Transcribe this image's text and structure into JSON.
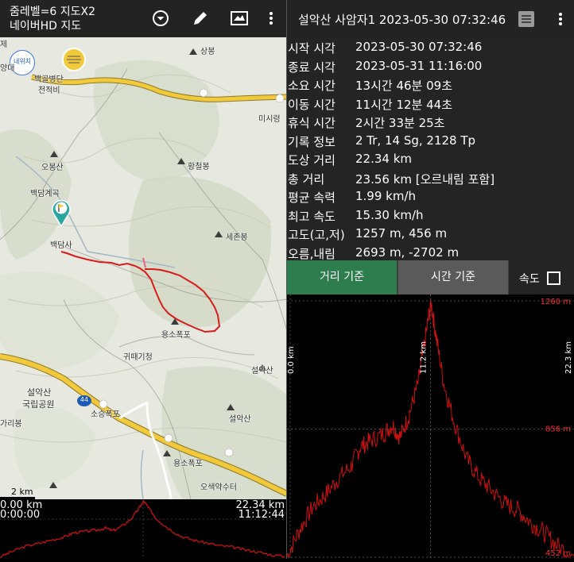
{
  "left_toolbar": {
    "zoom_text": "줌레벨=6 지도X2",
    "map_name": "네이버HD 지도",
    "icons": [
      "dropdown-circle-icon",
      "pencil-icon",
      "map-layers-icon",
      "more-vert-icon"
    ]
  },
  "map": {
    "labels": {
      "sangbong": "상봉",
      "baekgol_1": "백골병단",
      "baekgol_2": "전적비",
      "misiryeong": "미시령",
      "obongsan": "오봉산",
      "hwangcheolbong": "황철봉",
      "baekdamgyegok": "백담계곡",
      "baekdamsa": "백담사",
      "sejeonbong": "세존봉",
      "yongsopokpo_1": "용소폭포",
      "gwittaegicheong": "귀때기청",
      "seoraksan_peak": "설악산",
      "park_1": "설악산",
      "park_2": "국립공원",
      "route_44": "44",
      "soseungpokpo": "소승폭포",
      "seoraksan_peak2": "설악산",
      "garibong": "가리봉",
      "yongsopokpo_2": "용소폭포",
      "osaekyaksu": "오색약수터",
      "nearby_badge": "내위치",
      "scale": "2 km",
      "edge_top_left_1": "제",
      "edge_top_left_2": "양대"
    }
  },
  "mini_chart": {
    "start_dist": "0.00 km",
    "start_time": "0:00:00",
    "end_dist": "22.34 km",
    "end_time": "11:12:44"
  },
  "right_header": {
    "title": "설악산 사암자1 2023-05-30 07:32:46",
    "icons": [
      "list-icon",
      "more-vert-icon"
    ]
  },
  "track_info": [
    {
      "label": "시작 시각",
      "value": "2023-05-30 07:32:46"
    },
    {
      "label": "종료 시각",
      "value": "2023-05-31 11:16:00"
    },
    {
      "label": "소요 시간",
      "value": "13시간 46분 09초"
    },
    {
      "label": "이동 시간",
      "value": "11시간 12분 44초"
    },
    {
      "label": "휴식 시간",
      "value": "2시간 33분 25초"
    },
    {
      "label": "기록 정보",
      "value": "2 Tr, 14 Sg, 2128 Tp"
    },
    {
      "label": "도상 거리",
      "value": "22.34 km"
    },
    {
      "label": "총 거리",
      "value": "23.56 km [오르내림 포함]"
    },
    {
      "label": "평균 속력",
      "value": "1.99 km/h"
    },
    {
      "label": "최고 속도",
      "value": "15.30 km/h"
    },
    {
      "label": "고도(고,저)",
      "value": "1257 m, 456 m"
    },
    {
      "label": "오름,내림",
      "value": "2693 m, -2702 m"
    }
  ],
  "tabs": {
    "distance": "거리 기준",
    "time": "시간 기준",
    "speed_label": "속도",
    "speed_checked": false,
    "active_color": "#2e7d4f",
    "inactive_color": "#5a5a5a"
  },
  "chart_data": {
    "type": "line",
    "title": "",
    "xlabel": "",
    "ylabel": "",
    "x_unit": "km",
    "ylim": [
      452,
      1260
    ],
    "y_tick_labels": [
      "1260 m",
      "856 m",
      "452 m"
    ],
    "x_tick_labels": [
      "0.0 km",
      "11.2 km",
      "22.3 km"
    ],
    "line_color": "#cc1111",
    "grid": true,
    "series": [
      {
        "x": [
          0,
          1,
          2,
          3,
          4,
          5,
          5.7,
          6.5,
          7.5,
          8.2,
          8.8,
          9.5,
          10.2,
          10.8,
          11.2,
          11.6,
          12.2,
          13,
          14,
          15,
          16,
          17,
          18,
          19,
          20,
          21,
          22.34
        ],
        "values": [
          455,
          540,
          610,
          650,
          700,
          740,
          800,
          820,
          840,
          870,
          830,
          900,
          1000,
          1150,
          1257,
          1150,
          1000,
          880,
          760,
          700,
          660,
          620,
          600,
          560,
          530,
          490,
          456
        ]
      }
    ]
  }
}
